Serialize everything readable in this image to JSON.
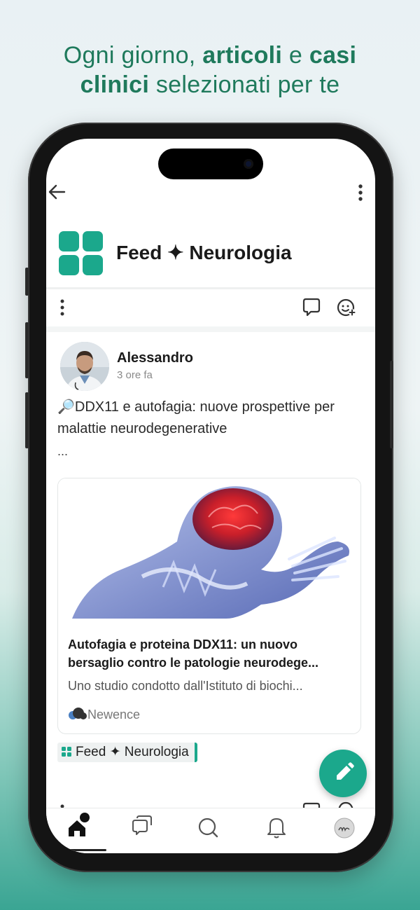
{
  "headline": {
    "part1": "Ogni giorno, ",
    "bold1": "articoli",
    "part2": " e ",
    "bold2": "casi",
    "bold3": "clinici",
    "part3": " selezionati per te"
  },
  "feed": {
    "title": "Feed ✦ Neurologia"
  },
  "post": {
    "author": "Alessandro",
    "time": "3 ore fa",
    "text": "🔎DDX11 e autofagia: nuove prospettive per malattie neurodegenerative",
    "ellipsis": "...",
    "card": {
      "title": "Autofagia e proteina DDX11: un nuovo bersaglio contro le patologie neurodege...",
      "description": "Uno studio condotto dall'Istituto di biochi...",
      "source": "Newence"
    },
    "tag": "Feed ✦ Neurologia"
  },
  "colors": {
    "accent": "#1ba88c",
    "headline": "#1f7a5c"
  },
  "icons": {
    "back": "arrow-left-icon",
    "more": "kebab-icon",
    "comment": "comment-icon",
    "react": "emoji-add-icon",
    "fab": "pencil-icon",
    "nav": [
      "home-icon",
      "chat-icon",
      "search-icon",
      "bell-icon",
      "profile-icon"
    ]
  }
}
